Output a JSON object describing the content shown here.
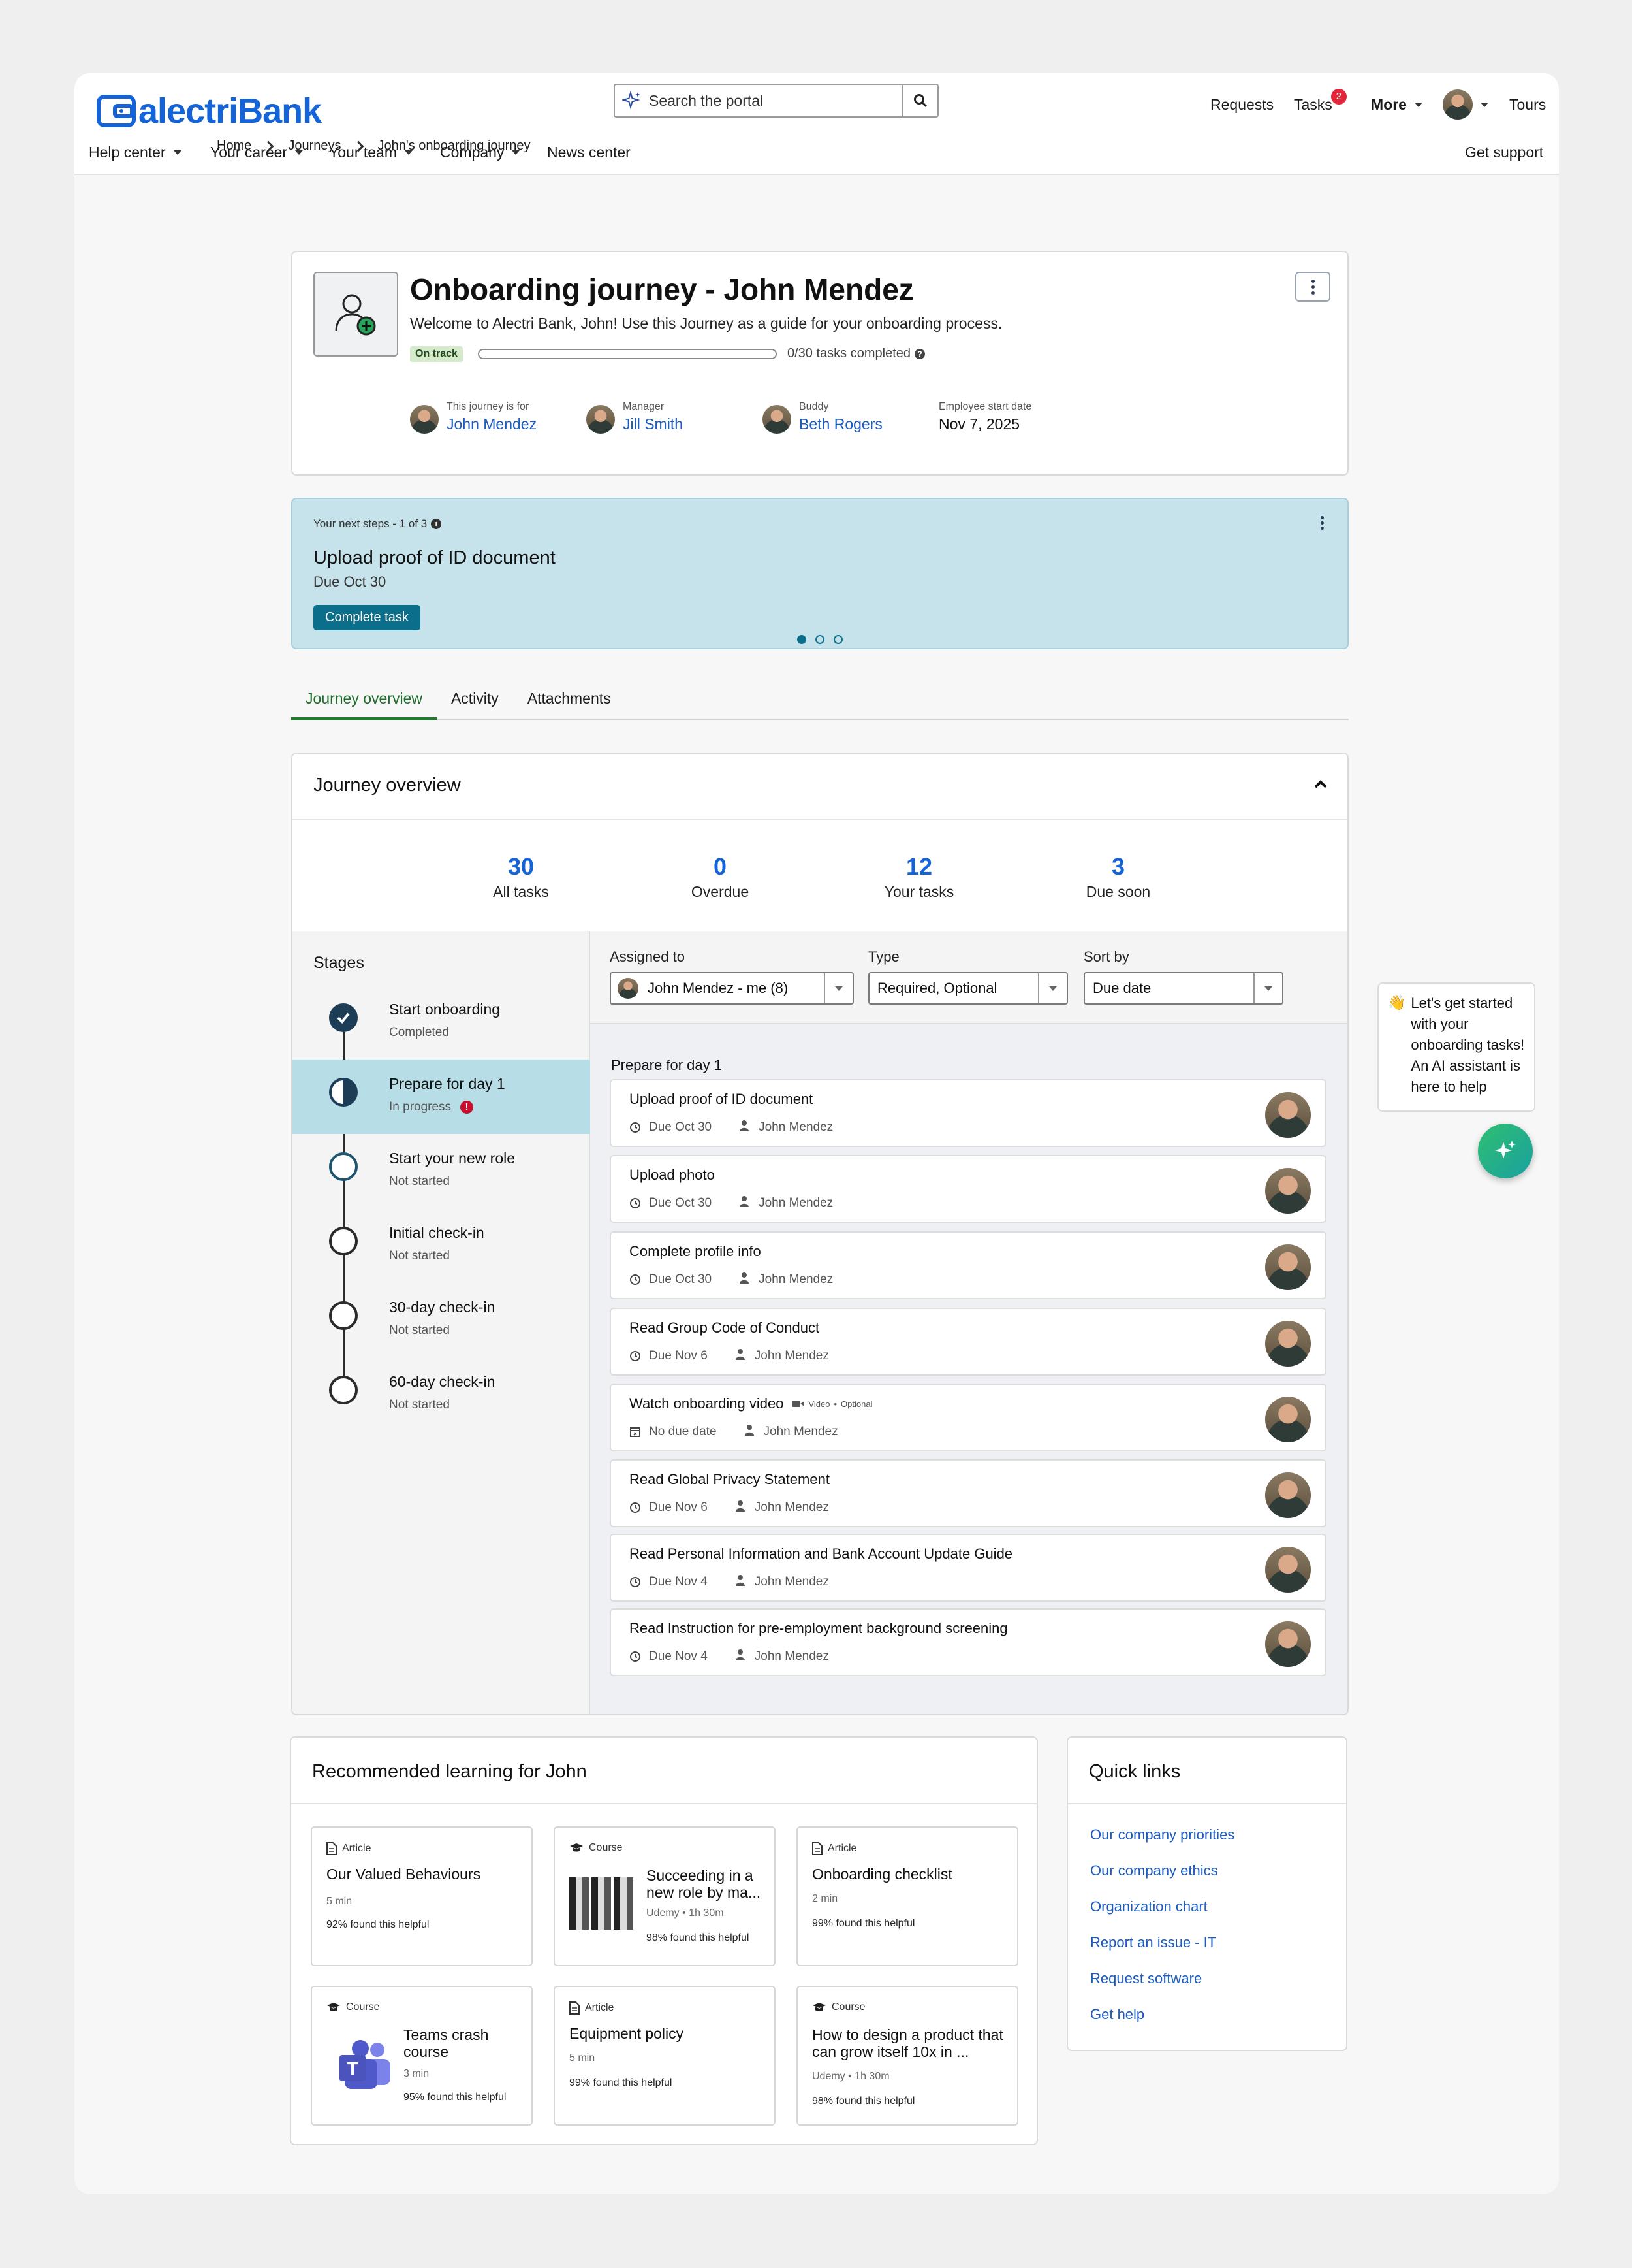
{
  "brand": {
    "name": "alectriBank",
    "color": "#1464d8"
  },
  "search": {
    "placeholder": "Search the portal"
  },
  "top_nav": {
    "requests": "Requests",
    "tasks": "Tasks",
    "tasks_badge": "2",
    "more": "More",
    "tours": "Tours"
  },
  "sub_nav": {
    "items": [
      "Help center",
      "Your career",
      "Your team",
      "Company",
      "News center"
    ],
    "support": "Get support"
  },
  "breadcrumb": [
    "Home",
    "Journeys",
    "John's onboarding journey"
  ],
  "journey": {
    "title": "Onboarding journey - John Mendez",
    "description": "Welcome to Alectri Bank, John! Use this Journey as a guide for your onboarding process.",
    "status": "On track",
    "progress_fraction": 0.0,
    "progress_text": "0/30 tasks completed",
    "people": [
      {
        "label": "This journey is for",
        "name": "John Mendez"
      },
      {
        "label": "Manager",
        "name": "Jill Smith"
      },
      {
        "label": "Buddy",
        "name": "Beth Rogers"
      }
    ],
    "start_date": {
      "label": "Employee start date",
      "value": "Nov 7, 2025"
    }
  },
  "next_steps": {
    "label": "Your next steps - 1 of 3",
    "title": "Upload proof of ID document",
    "due": "Due Oct 30",
    "cta": "Complete task",
    "page_active": 0,
    "page_count": 3
  },
  "tabs": [
    "Journey overview",
    "Activity",
    "Attachments"
  ],
  "overview": {
    "title": "Journey overview",
    "stats": [
      {
        "value": "30",
        "label": "All tasks"
      },
      {
        "value": "0",
        "label": "Overdue"
      },
      {
        "value": "12",
        "label": "Your tasks"
      },
      {
        "value": "3",
        "label": "Due soon"
      }
    ],
    "stages_title": "Stages",
    "stages": [
      {
        "name": "Start onboarding",
        "status": "Completed",
        "state": "done"
      },
      {
        "name": "Prepare for day 1",
        "status": "In progress",
        "state": "active"
      },
      {
        "name": "Start your new role",
        "status": "Not started",
        "state": "upcoming"
      },
      {
        "name": "Initial check-in",
        "status": "Not started",
        "state": "todo"
      },
      {
        "name": "30-day check-in",
        "status": "Not started",
        "state": "todo"
      },
      {
        "name": "60-day check-in",
        "status": "Not started",
        "state": "todo"
      }
    ],
    "filters": {
      "assigned": {
        "label": "Assigned to",
        "value": "John Mendez - me (8)"
      },
      "type": {
        "label": "Type",
        "value": "Required, Optional"
      },
      "sort": {
        "label": "Sort by",
        "value": "Due date"
      }
    },
    "group_title": "Prepare for day 1",
    "tasks": [
      {
        "title": "Upload proof of ID document",
        "due": "Due Oct 30",
        "assignee": "John Mendez"
      },
      {
        "title": "Upload photo",
        "due": "Due Oct 30",
        "assignee": "John Mendez"
      },
      {
        "title": "Complete profile info",
        "due": "Due Oct 30",
        "assignee": "John Mendez"
      },
      {
        "title": "Read Group Code of Conduct",
        "due": "Due Nov 6",
        "assignee": "John Mendez"
      },
      {
        "title": "Watch onboarding video",
        "due": "No due date",
        "assignee": "John Mendez",
        "tag_video": "Video",
        "tag_optional": "Optional"
      },
      {
        "title": "Read Global Privacy Statement",
        "due": "Due Nov 6",
        "assignee": "John Mendez"
      },
      {
        "title": "Read Personal Information and Bank Account Update Guide",
        "due": "Due Nov 4",
        "assignee": "John Mendez"
      },
      {
        "title": "Read Instruction for pre-employment background screening",
        "due": "Due Nov 4",
        "assignee": "John Mendez"
      }
    ]
  },
  "learning": {
    "title": "Recommended learning for John",
    "cards": [
      {
        "type": "Article",
        "title": "Our Valued Behaviours",
        "meta": "5 min",
        "helpful": "92% found this helpful"
      },
      {
        "type": "Course",
        "title": "Succeeding in a new role by ma...",
        "meta": "Udemy • 1h 30m",
        "helpful": "98% found this helpful"
      },
      {
        "type": "Article",
        "title": "Onboarding checklist",
        "meta": "2 min",
        "helpful": "99% found this helpful"
      },
      {
        "type": "Course",
        "title": "Teams crash course",
        "meta": "3 min",
        "helpful": "95% found this helpful"
      },
      {
        "type": "Article",
        "title": "Equipment policy",
        "meta": "5 min",
        "helpful": "99% found this helpful"
      },
      {
        "type": "Course",
        "title": "How to design a product that can grow itself 10x in ...",
        "meta": "Udemy • 1h 30m",
        "helpful": "98% found this helpful"
      }
    ]
  },
  "quick_links": {
    "title": "Quick links",
    "items": [
      "Our company priorities",
      "Our company ethics",
      "Organization chart",
      "Report an issue - IT",
      "Request software",
      "Get help"
    ]
  },
  "assistant": {
    "emoji": "👋",
    "message": "Let's get started with your onboarding tasks! An AI assistant is here to help"
  }
}
